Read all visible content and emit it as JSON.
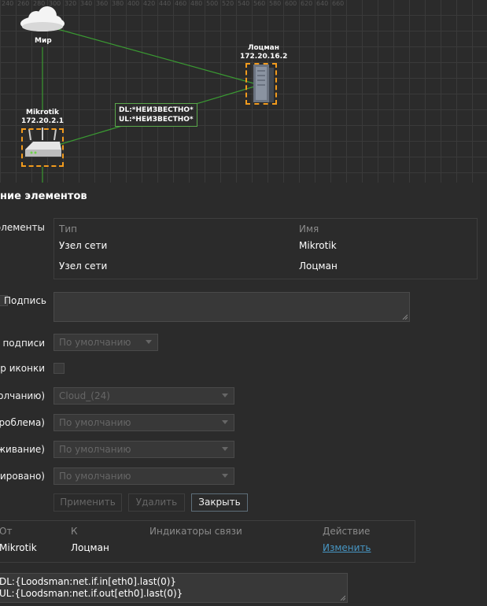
{
  "map": {
    "ruler": [
      "240",
      "260",
      "280",
      "300",
      "320",
      "340",
      "360",
      "380",
      "400",
      "420",
      "440",
      "460",
      "480",
      "500",
      "520",
      "540",
      "560",
      "580",
      "600",
      "620",
      "640",
      "660"
    ],
    "nodes": {
      "mir": {
        "label": "Мир"
      },
      "mikrotik": {
        "name": "Mikrotik",
        "ip": "172.20.2.1"
      },
      "locman": {
        "name": "Лоцман",
        "ip": "172.20.16.2"
      }
    },
    "link_label": {
      "dl": "DL:*НЕИЗВЕСТНО*",
      "ul": "UL:*НЕИЗВЕСТНО*"
    },
    "colors": {
      "link": "#3a9a32",
      "selection": "#f29b1d"
    }
  },
  "panel": {
    "title": "ние элементов",
    "elements_label": "элементы",
    "elements_table": {
      "headers": {
        "type": "Тип",
        "name": "Имя"
      },
      "rows": [
        {
          "type": "Узел сети",
          "name": "Mikrotik"
        },
        {
          "type": "Узел сети",
          "name": "Лоцман"
        }
      ]
    },
    "label_checkbox": "Подпись",
    "label_position": {
      "label": "е подписи",
      "value": "По умолчанию"
    },
    "auto_icon": {
      "label": "бор иконки"
    },
    "icons": [
      {
        "label": "молчанию)",
        "value": "Cloud_(24)"
      },
      {
        "label": "проблема)",
        "value": "По умолчанию"
      },
      {
        "label": "уживание)",
        "value": "По умолчанию"
      },
      {
        "label": "ивировано)",
        "value": "По умолчанию"
      }
    ],
    "buttons": {
      "apply": "Применить",
      "remove": "Удалить",
      "close": "Закрыть"
    },
    "links_table": {
      "headers": {
        "from": "От",
        "to": "К",
        "indicators": "Индикаторы связи",
        "action": "Действие"
      },
      "row": {
        "from": "Mikrotik",
        "to": "Лоцман",
        "indicators": "",
        "action": "Изменить"
      }
    },
    "link_label_text": [
      "DL:{Loodsman:net.if.in[eth0].last(0)}",
      "UL:{Loodsman:net.if.out[eth0].last(0)}"
    ]
  }
}
